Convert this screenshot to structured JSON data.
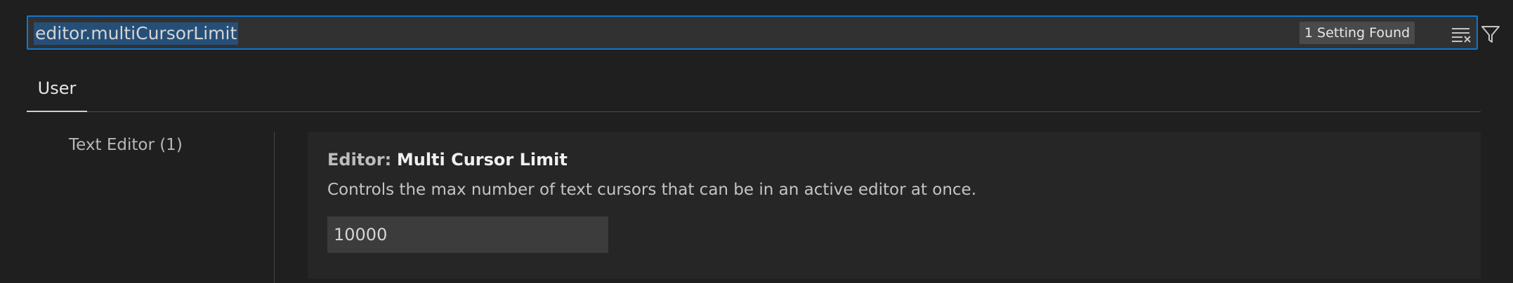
{
  "search": {
    "value": "editor.multiCursorLimit",
    "results_badge": "1 Setting Found",
    "clear_icon": "clear-filter-icon",
    "filter_icon": "filter-icon",
    "focus_color": "#0e78d4",
    "selection_color": "#264f78"
  },
  "tabs": [
    {
      "label": "User",
      "active": true
    }
  ],
  "toc": [
    {
      "label": "Text Editor (1)"
    }
  ],
  "setting": {
    "category": "Editor:",
    "name": "Multi Cursor Limit",
    "description": "Controls the max number of text cursors that can be in an active editor at once.",
    "value": "10000"
  }
}
